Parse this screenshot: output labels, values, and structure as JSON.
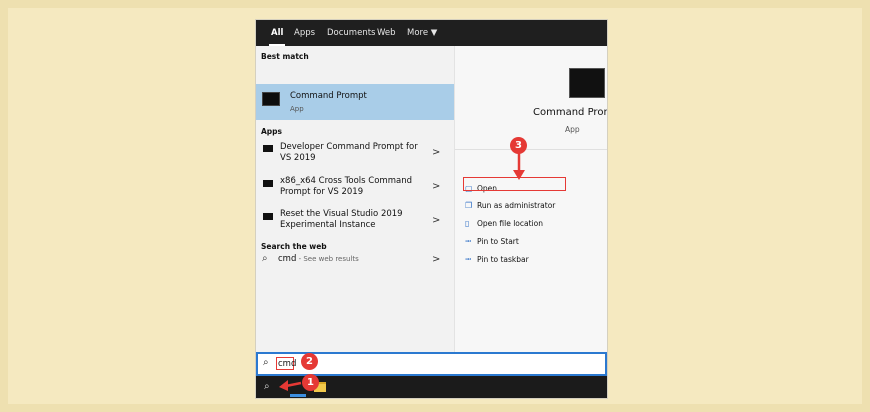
{
  "tabs": [
    {
      "label": "All",
      "active": true
    },
    {
      "label": "Apps"
    },
    {
      "label": "Documents"
    },
    {
      "label": "Web"
    },
    {
      "label": "More ▼"
    }
  ],
  "best_match": {
    "section": "Best match",
    "title": "Command Prompt",
    "subtitle": "App"
  },
  "apps": {
    "section": "Apps",
    "items": [
      {
        "title": "Developer Command Prompt for VS 2019"
      },
      {
        "title": "x86_x64 Cross Tools Command Prompt for VS 2019"
      },
      {
        "title": "Reset the Visual Studio 2019 Experimental Instance"
      }
    ]
  },
  "web": {
    "section": "Search the web",
    "query": "cmd",
    "suffix": " - See web results"
  },
  "preview": {
    "title": "Command Prom",
    "subtitle": "App"
  },
  "actions": [
    {
      "label": "Open",
      "icon": "open-icon"
    },
    {
      "label": "Run as administrator",
      "icon": "admin-shield-icon"
    },
    {
      "label": "Open file location",
      "icon": "file-location-icon"
    },
    {
      "label": "Pin to Start",
      "icon": "pin-icon"
    },
    {
      "label": "Pin to taskbar",
      "icon": "pin-icon"
    }
  ],
  "search": {
    "value": "cmd"
  },
  "badges": {
    "one": "1",
    "two": "2",
    "three": "3"
  },
  "colors": {
    "accent": "#2b79d0",
    "highlight": "#a9cde8",
    "annotation": "#e53935",
    "background": "#f5e9c0"
  }
}
